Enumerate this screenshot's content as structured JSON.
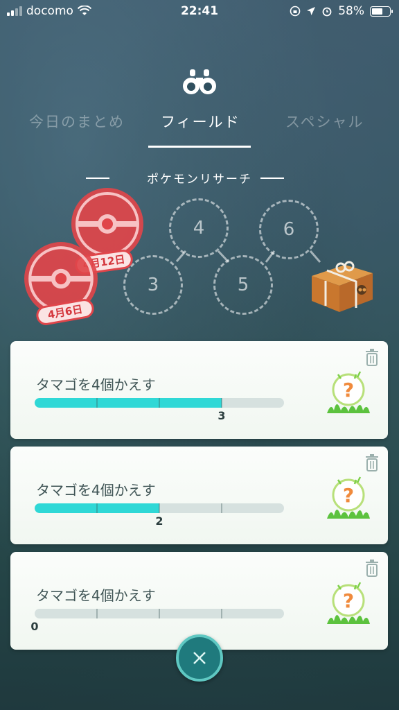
{
  "status_bar": {
    "carrier": "docomo",
    "time": "22:41",
    "battery": "58%"
  },
  "tabs": [
    {
      "label": "今日のまとめ",
      "active": false
    },
    {
      "label": "フィールド",
      "active": true
    },
    {
      "label": "スペシャル",
      "active": false
    }
  ],
  "research": {
    "title": "ポケモンリサーチ",
    "stamps": [
      {
        "date": "4月12日"
      },
      {
        "date": "4月6日"
      }
    ],
    "slots": [
      "3",
      "4",
      "5",
      "6"
    ]
  },
  "tasks": [
    {
      "title": "タマゴを4個かえす",
      "progress": 3,
      "goal": 4,
      "count": "3"
    },
    {
      "title": "タマゴを4個かえす",
      "progress": 2,
      "goal": 4,
      "count": "2"
    },
    {
      "title": "タマゴを4個かえす",
      "progress": 0,
      "goal": 4,
      "count": "0"
    }
  ],
  "icons": {
    "reward": "question-mark-reward-icon",
    "trash": "trash-icon",
    "close": "close-icon",
    "header": "binoculars-icon"
  },
  "colors": {
    "progress": "#2fd8d6",
    "stamp": "#e0454a",
    "close_button": "#1f7a7d"
  }
}
